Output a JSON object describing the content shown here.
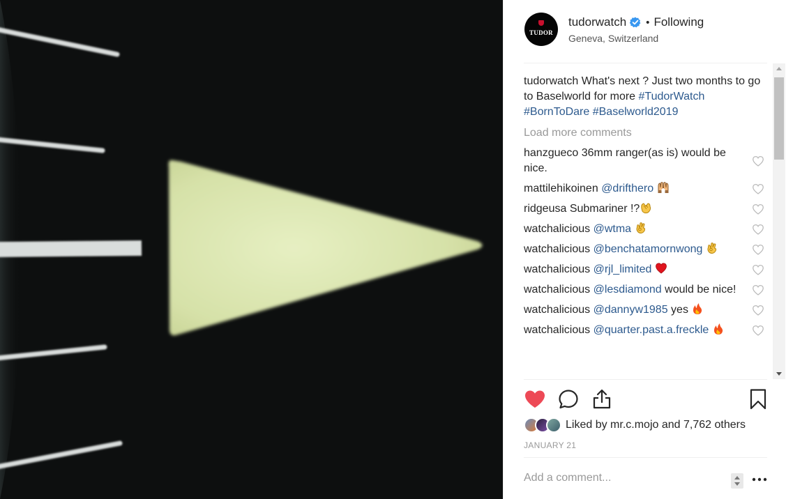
{
  "post": {
    "username": "tudorwatch",
    "follow_status": "Following",
    "location": "Geneva, Switzerland",
    "avatar_logo_text": "TUDOR"
  },
  "caption": {
    "username": "tudorwatch",
    "text": "What's next ? Just two months to go to Baselworld for more",
    "tags": [
      "#TudorWatch",
      "#BornToDare",
      "#Baselworld2019"
    ]
  },
  "load_more_label": "Load more comments",
  "comments": [
    {
      "username": "hanzgueco",
      "text": "36mm ranger(as is) would be nice.",
      "mention": "",
      "emoji": ""
    },
    {
      "username": "mattilehikoinen",
      "text": "",
      "mention": "@drifthero",
      "emoji": "raising-hands"
    },
    {
      "username": "ridgeusa",
      "text": "Submariner !?",
      "mention": "",
      "emoji": "clapping-hands"
    },
    {
      "username": "watchalicious",
      "text": "",
      "mention": "@wtma",
      "emoji": "ok-hand"
    },
    {
      "username": "watchalicious",
      "text": "",
      "mention": "@benchatamornwong",
      "emoji": "ok-hand"
    },
    {
      "username": "watchalicious",
      "text": "",
      "mention": "@rjl_limited",
      "emoji": "red-heart"
    },
    {
      "username": "watchalicious",
      "text": "would be nice!",
      "mention": "@lesdiamond",
      "emoji": ""
    },
    {
      "username": "watchalicious",
      "text": "yes",
      "mention": "@dannyw1985",
      "emoji": "fire"
    },
    {
      "username": "watchalicious",
      "text": "",
      "mention": "@quarter.past.a.freckle",
      "emoji": "fire"
    }
  ],
  "likes": {
    "prefix": "Liked by",
    "user": "mr.c.mojo",
    "conjunction": "and",
    "count_text": "7,762 others"
  },
  "date": "JANUARY 21",
  "add_comment_placeholder": "Add a comment...",
  "colors": {
    "like_red": "#ed4956",
    "link_blue": "#2d5a8e",
    "verified_blue": "#3897f0",
    "photo_bg": "#0d0f0f",
    "lume_green": "#dfe8b8"
  },
  "icons": {
    "like": "heart-filled-icon",
    "comment": "speech-bubble-icon",
    "share": "share-upload-icon",
    "save": "bookmark-icon",
    "verified": "verified-badge-icon",
    "more": "more-dots-icon"
  }
}
